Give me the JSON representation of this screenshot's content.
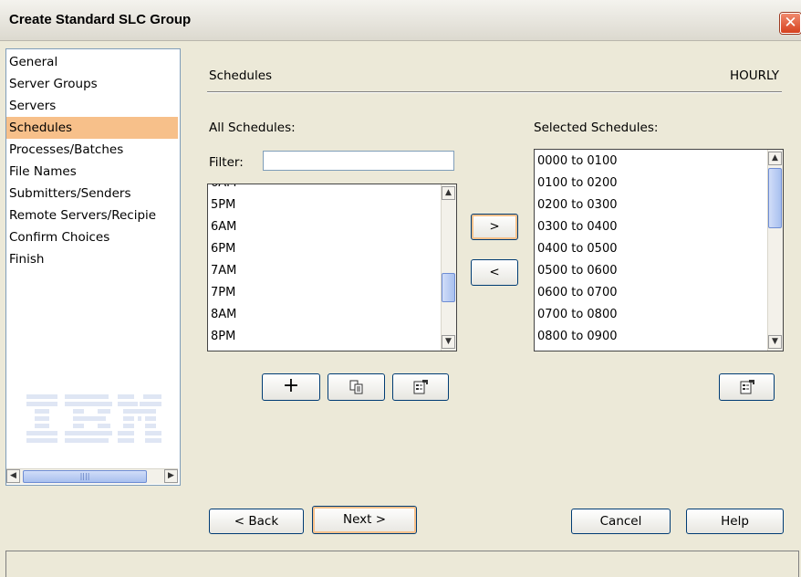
{
  "window": {
    "title": "Create Standard SLC Group",
    "close_glyph": "✕"
  },
  "nav": {
    "items": [
      "General",
      "Server Groups",
      "Servers",
      "Schedules",
      "Processes/Batches",
      "File Names",
      "Submitters/Senders",
      "Remote Servers/Recipie",
      "Confirm Choices",
      "Finish"
    ],
    "active_index": 3
  },
  "logo": {
    "text": "IBM"
  },
  "section": {
    "title": "Schedules",
    "frequency": "HOURLY"
  },
  "all_schedules": {
    "label": "All Schedules:",
    "filter_label": "Filter:",
    "filter_value": "",
    "items": [
      "5PM",
      "6AM",
      "6PM",
      "7AM",
      "7PM",
      "8AM",
      "8PM"
    ]
  },
  "transfer": {
    "add_label": ">",
    "remove_label": "<"
  },
  "selected_schedules": {
    "label": "Selected Schedules:",
    "items": [
      "0000 to 0100",
      "0100 to 0200",
      "0200 to 0300",
      "0300 to 0400",
      "0400 to 0500",
      "0500 to 0600",
      "0600 to 0700",
      "0700 to 0800",
      "0800 to 0900"
    ]
  },
  "toolbar": {
    "new_glyph": "+",
    "copy_icon": "copy-icon",
    "properties_icon": "properties-icon"
  },
  "footer": {
    "back_label": "< Back",
    "next_label": "Next >",
    "cancel_label": "Cancel",
    "help_label": "Help"
  }
}
